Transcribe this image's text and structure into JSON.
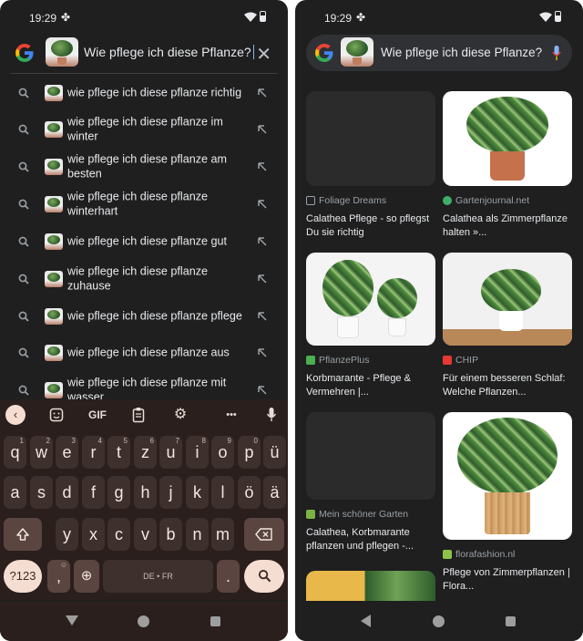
{
  "status": {
    "time": "19:29"
  },
  "left": {
    "query": "Wie pflege ich diese Pflanze?",
    "suggestions": [
      "wie pflege ich diese pflanze richtig",
      "wie pflege ich diese pflanze im winter",
      "wie pflege ich diese pflanze am besten",
      "wie pflege ich diese pflanze winterhart",
      "wie pflege ich diese pflanze gut",
      "wie pflege ich diese pflanze zuhause",
      "wie pflege ich diese pflanze pflege",
      "wie pflege ich diese pflanze aus",
      "wie pflege ich diese pflanze mit wasser"
    ],
    "keyboard": {
      "toolbar": {
        "gif": "GIF",
        "more": "•••"
      },
      "row1": [
        {
          "k": "q",
          "s": "1"
        },
        {
          "k": "w",
          "s": "2"
        },
        {
          "k": "e",
          "s": "3"
        },
        {
          "k": "r",
          "s": "4"
        },
        {
          "k": "t",
          "s": "5"
        },
        {
          "k": "z",
          "s": "6"
        },
        {
          "k": "u",
          "s": "7"
        },
        {
          "k": "i",
          "s": "8"
        },
        {
          "k": "o",
          "s": "9"
        },
        {
          "k": "p",
          "s": "0"
        },
        {
          "k": "ü",
          "s": ""
        }
      ],
      "row2": [
        "a",
        "s",
        "d",
        "f",
        "g",
        "h",
        "j",
        "k",
        "l",
        "ö",
        "ä"
      ],
      "row3": [
        "y",
        "x",
        "c",
        "v",
        "b",
        "n",
        "m"
      ],
      "n123": "?123",
      "comma": ",",
      "space_label": "DE • FR",
      "period": "."
    }
  },
  "right": {
    "query": "Wie pflege ich diese Pflanze?",
    "results": [
      {
        "source": "Foliage Dreams",
        "title": "Calathea Pflege - so pflegst Du sie richtig",
        "fav_color": "#202124"
      },
      {
        "source": "Gartenjournal.net",
        "title": "Calathea als Zimmerpflanze halten »...",
        "fav_color": "#3fae6a"
      },
      {
        "source": "PflanzePlus",
        "title": "Korbmarante - Pflege & Vermehren |...",
        "fav_color": "#4caf50"
      },
      {
        "source": "CHIP",
        "title": "Für einem besseren Schlaf: Welche Pflanzen...",
        "fav_color": "#e53935"
      },
      {
        "source": "Mein schöner Garten",
        "title": "Calathea, Korbmarante pflanzen und pflegen -...",
        "fav_color": "#7cb342"
      },
      {
        "source": "florafashion.nl",
        "title": "Pflege von Zimmerpflanzen | Flora...",
        "fav_color": "#8bc34a"
      }
    ]
  },
  "colors": {
    "background": "#1f1f1f",
    "keyboard_bg": "#2a1f1d",
    "key_bg": "#3d302d",
    "key_accent": "#f5ddd2",
    "mic": "#8ab4f8"
  }
}
